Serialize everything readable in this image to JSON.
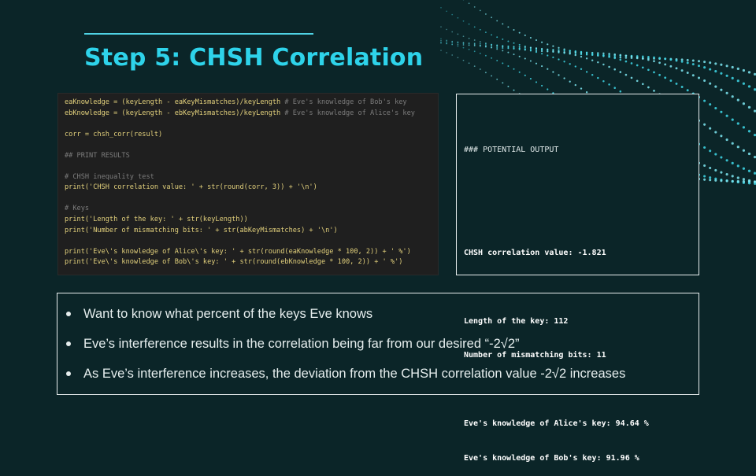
{
  "slide": {
    "title": "Step 5: CHSH Correlation"
  },
  "code": {
    "lines": [
      {
        "code": "eaKnowledge = (keyLength - eaKeyMismatches)/keyLength ",
        "comment": "# Eve's knowledge of Bob's key"
      },
      {
        "code": "ebKnowledge = (keyLength - ebKeyMismatches)/keyLength ",
        "comment": "# Eve's knowledge of Alice's key"
      },
      {
        "code": "",
        "comment": ""
      },
      {
        "code": "corr = chsh_corr(result)",
        "comment": ""
      },
      {
        "code": "",
        "comment": ""
      },
      {
        "code": "",
        "comment": "## PRINT RESULTS"
      },
      {
        "code": "",
        "comment": ""
      },
      {
        "code": "",
        "comment": "# CHSH inequality test"
      },
      {
        "code": "print('CHSH correlation value: ' + str(round(corr, 3)) + '\\n')",
        "comment": ""
      },
      {
        "code": "",
        "comment": ""
      },
      {
        "code": "",
        "comment": "# Keys"
      },
      {
        "code": "print('Length of the key: ' + str(keyLength))",
        "comment": ""
      },
      {
        "code": "print('Number of mismatching bits: ' + str(abKeyMismatches) + '\\n')",
        "comment": ""
      },
      {
        "code": "",
        "comment": ""
      },
      {
        "code": "print('Eve\\'s knowledge of Alice\\'s key: ' + str(round(eaKnowledge * 100, 2)) + ' %')",
        "comment": ""
      },
      {
        "code": "print('Eve\\'s knowledge of Bob\\'s key: ' + str(round(ebKnowledge * 100, 2)) + ' %')",
        "comment": ""
      }
    ]
  },
  "output": {
    "header": "### POTENTIAL OUTPUT",
    "correlation": "CHSH correlation value: -1.821",
    "key_length": "Length of the key: 112",
    "mismatching_bits": "Number of mismatching bits: 11",
    "alice_knowledge": "Eve's knowledge of Alice's key: 94.64 %",
    "bob_knowledge": "Eve's knowledge of Bob's key: 91.96 %"
  },
  "bullets": [
    "Want to know what percent of the keys Eve knows",
    "Eve’s interference results in the correlation being far from our desired “-2√2”",
    "As Eve’s interference increases, the deviation from the CHSH correlation value -2√2 increases"
  ],
  "colors": {
    "background": "#0b2528",
    "accent": "#2ed3ea",
    "code_text": "#e3d17c",
    "code_comment": "#7d7d7d"
  }
}
